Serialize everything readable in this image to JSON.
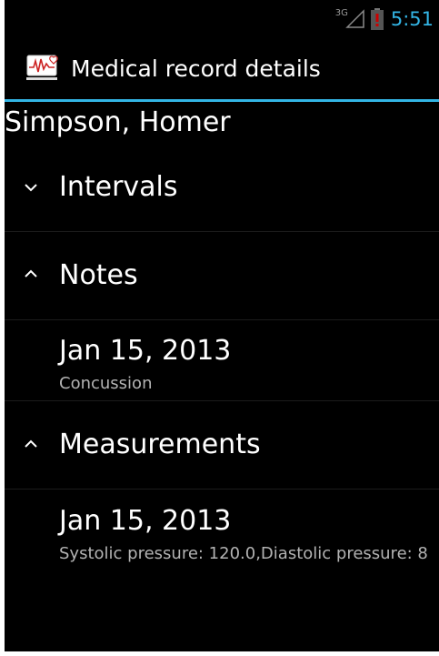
{
  "status_bar": {
    "network_type": "3G",
    "time": "5:51"
  },
  "action_bar": {
    "title": "Medical record details"
  },
  "patient": {
    "name": "Simpson, Homer"
  },
  "groups": [
    {
      "label": "Intervals",
      "expanded": false
    },
    {
      "label": "Notes",
      "expanded": true,
      "items": [
        {
          "title": "Jan 15, 2013",
          "subtitle": "Concussion"
        }
      ]
    },
    {
      "label": "Measurements",
      "expanded": true,
      "items": [
        {
          "title": "Jan 15, 2013",
          "subtitle": "Systolic pressure: 120.0,Diastolic pressure: 8"
        }
      ]
    }
  ],
  "colors": {
    "accent": "#33b5e5",
    "background": "#000000",
    "text_primary": "#ffffff",
    "text_secondary": "#b3b3b3",
    "battery_alert": "#cc0000"
  }
}
